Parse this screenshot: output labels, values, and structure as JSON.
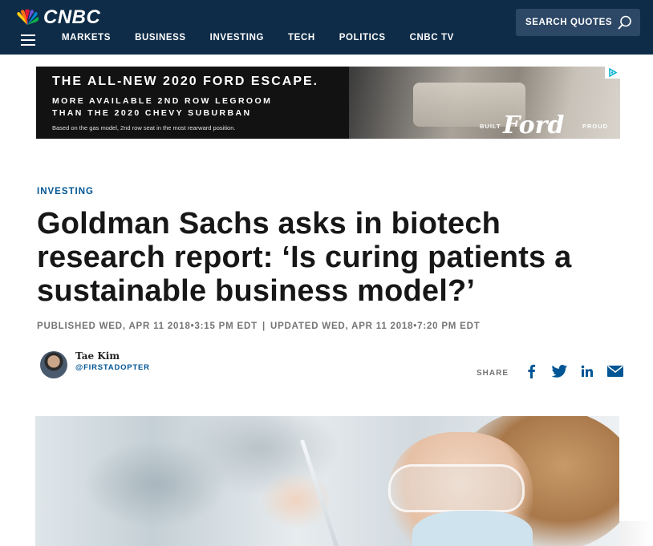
{
  "header": {
    "brand": "CNBC",
    "nav": [
      "MARKETS",
      "BUSINESS",
      "INVESTING",
      "TECH",
      "POLITICS",
      "CNBC TV"
    ],
    "search_label": "SEARCH QUOTES",
    "bg_color": "#0e2c48"
  },
  "ad": {
    "headline": "THE ALL-NEW 2020 FORD ESCAPE.",
    "subline_1": "MORE AVAILABLE 2ND ROW LEGROOM",
    "subline_2": "THAN THE 2020 CHEVY SUBURBAN",
    "fine_print": "Based on the gas model, 2nd row seat in the most rearward position.",
    "built": "BUILT",
    "brand": "Ford",
    "proud": "PROUD"
  },
  "article": {
    "kicker": "INVESTING",
    "title": "Goldman Sachs asks in biotech research report: ‘Is curing patients a sustainable business model?’",
    "published": "PUBLISHED WED, APR 11 2018•3:15 PM EDT",
    "separator": "|",
    "updated": "UPDATED WED, APR 11 2018•7:20 PM EDT",
    "author_name": "Tae Kim",
    "author_handle": "@FIRSTADOPTER",
    "share_label": "SHARE",
    "accent_color": "#005594"
  }
}
